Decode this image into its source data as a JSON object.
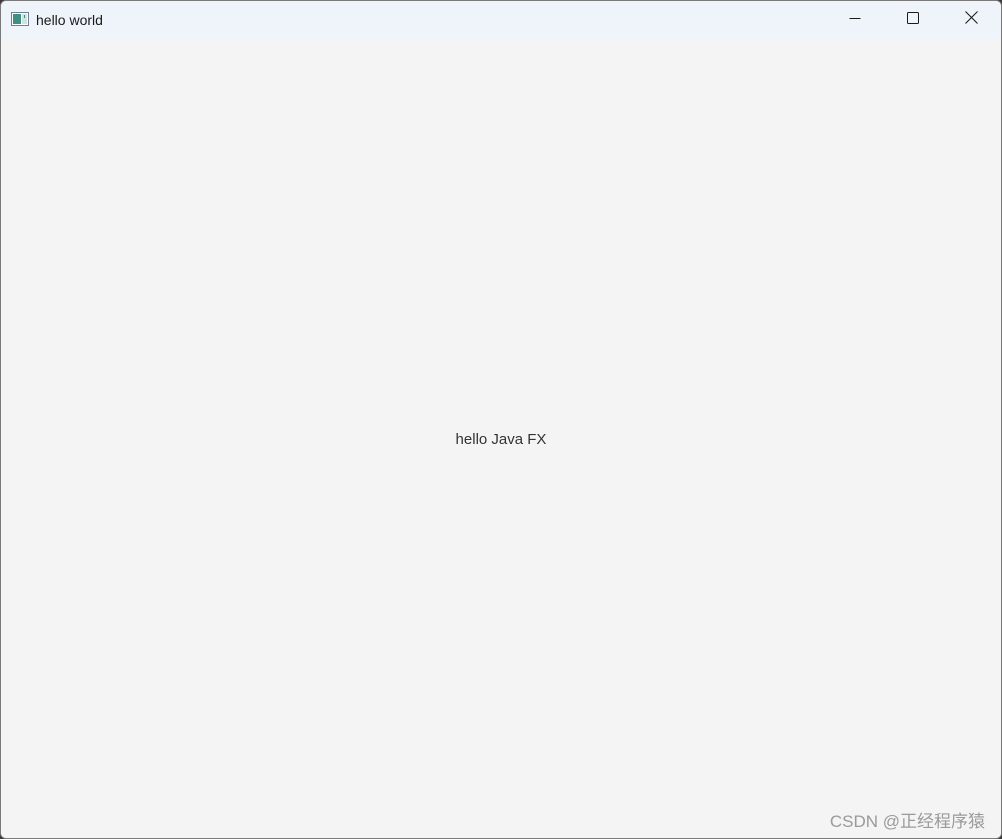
{
  "window": {
    "title": "hello world",
    "app_icon": "javafx-window-icon",
    "controls": {
      "minimize_icon": "minimize-icon",
      "maximize_icon": "maximize-icon",
      "close_icon": "close-icon"
    }
  },
  "content": {
    "label": "hello Java FX"
  },
  "watermark": {
    "text": "CSDN @正经程序猿"
  },
  "colors": {
    "titlebar_bg": "#eff4fb",
    "content_bg": "#f4f4f4",
    "text": "#333333",
    "watermark": "#9a9a9a"
  }
}
